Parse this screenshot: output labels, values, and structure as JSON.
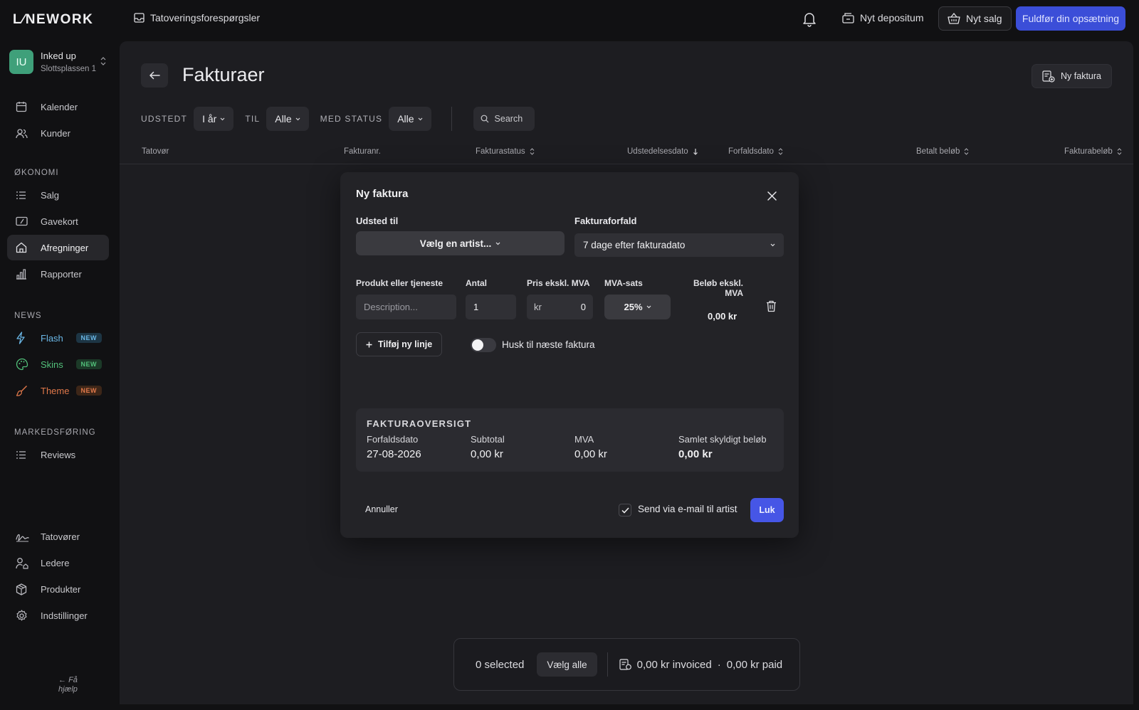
{
  "app": {
    "logo": "L⁄NEWORK",
    "inbox_label": "Tatoveringsforespørgsler",
    "deposit_label": "Nyt depositum",
    "new_sale_label": "Nyt salg",
    "finish_setup_label": "Fuldfør din opsætning"
  },
  "workspace": {
    "initials": "IU",
    "name": "Inked up",
    "address": "Slottsplassen 1"
  },
  "sidebar": {
    "main_items": [
      {
        "label": "Kalender",
        "icon": "calendar-icon"
      },
      {
        "label": "Kunder",
        "icon": "users-icon"
      }
    ],
    "section_economy": "ØKONOMI",
    "economy_items": [
      {
        "label": "Salg",
        "icon": "list-icon"
      },
      {
        "label": "Gavekort",
        "icon": "giftcard-icon"
      },
      {
        "label": "Afregninger",
        "icon": "house-icon"
      },
      {
        "label": "Rapporter",
        "icon": "bar-chart-icon"
      }
    ],
    "section_news": "NEWS",
    "news_items": [
      {
        "label": "Flash",
        "badge": "NEW",
        "color": "#6ab7e6",
        "icon": "flash-icon"
      },
      {
        "label": "Skins",
        "badge": "NEW",
        "color": "#52c07a",
        "icon": "palette-icon"
      },
      {
        "label": "Theme",
        "badge": "NEW",
        "color": "#e0784a",
        "icon": "brush-icon"
      }
    ],
    "section_marketing": "MARKEDSFØRING",
    "marketing_items": [
      {
        "label": "Reviews",
        "icon": "list-icon"
      }
    ],
    "bottom_items": [
      {
        "label": "Tatovører",
        "icon": "signature-icon"
      },
      {
        "label": "Ledere",
        "icon": "manager-icon"
      },
      {
        "label": "Produkter",
        "icon": "box-icon"
      },
      {
        "label": "Indstillinger",
        "icon": "gear-icon"
      }
    ],
    "help_label": "Få hjælp"
  },
  "page": {
    "title": "Fakturaer",
    "new_invoice_label": "Ny faktura",
    "filters": {
      "issued_label": "UDSTEDT",
      "issued_value": "I år",
      "to_label": "TIL",
      "to_value": "Alle",
      "status_label": "MED STATUS",
      "status_value": "Alle",
      "search_placeholder": "Search"
    },
    "columns": [
      "Tatovør",
      "Fakturanr.",
      "Fakturastatus",
      "Udstedelsesdato",
      "Forfaldsdato",
      "Betalt beløb",
      "Fakturabeløb"
    ]
  },
  "bottom_bar": {
    "selected": "0 selected",
    "select_all": "Vælg alle",
    "invoiced": "0,00 kr invoiced",
    "separator": "·",
    "paid": "0,00 kr paid"
  },
  "modal": {
    "title": "Ny faktura",
    "issued_to_label": "Udsted til",
    "artist_placeholder": "Vælg en artist...",
    "due_label": "Fakturaforfald",
    "due_value": "7 dage efter fakturadato",
    "col_product": "Produkt eller tjeneste",
    "col_qty": "Antal",
    "col_price": "Pris ekskl. MVA",
    "col_vat": "MVA-sats",
    "col_amount": "Beløb ekskl. MVA",
    "description_placeholder": "Description...",
    "qty_value": "1",
    "price_currency": "kr",
    "price_value": "0",
    "vat_value": "25%",
    "line_amount": "0,00 kr",
    "add_line": "Tilføj ny linje",
    "remember_label": "Husk til næste faktura",
    "remember_on": false,
    "summary": {
      "title": "FAKTURAOVERSIGT",
      "due_date_label": "Forfaldsdato",
      "due_date_value": "27-08-2026",
      "subtotal_label": "Subtotal",
      "subtotal_value": "0,00 kr",
      "vat_label": "MVA",
      "vat_value": "0,00 kr",
      "total_label": "Samlet skyldigt beløb",
      "total_value": "0,00 kr"
    },
    "cancel_label": "Annuller",
    "send_email_label": "Send via e-mail til artist",
    "send_email_checked": true,
    "close_label": "Luk"
  },
  "colors": {
    "accent": "#4656e6",
    "finish_button": "#3b4ed8",
    "avatar": "#3fa07a"
  }
}
